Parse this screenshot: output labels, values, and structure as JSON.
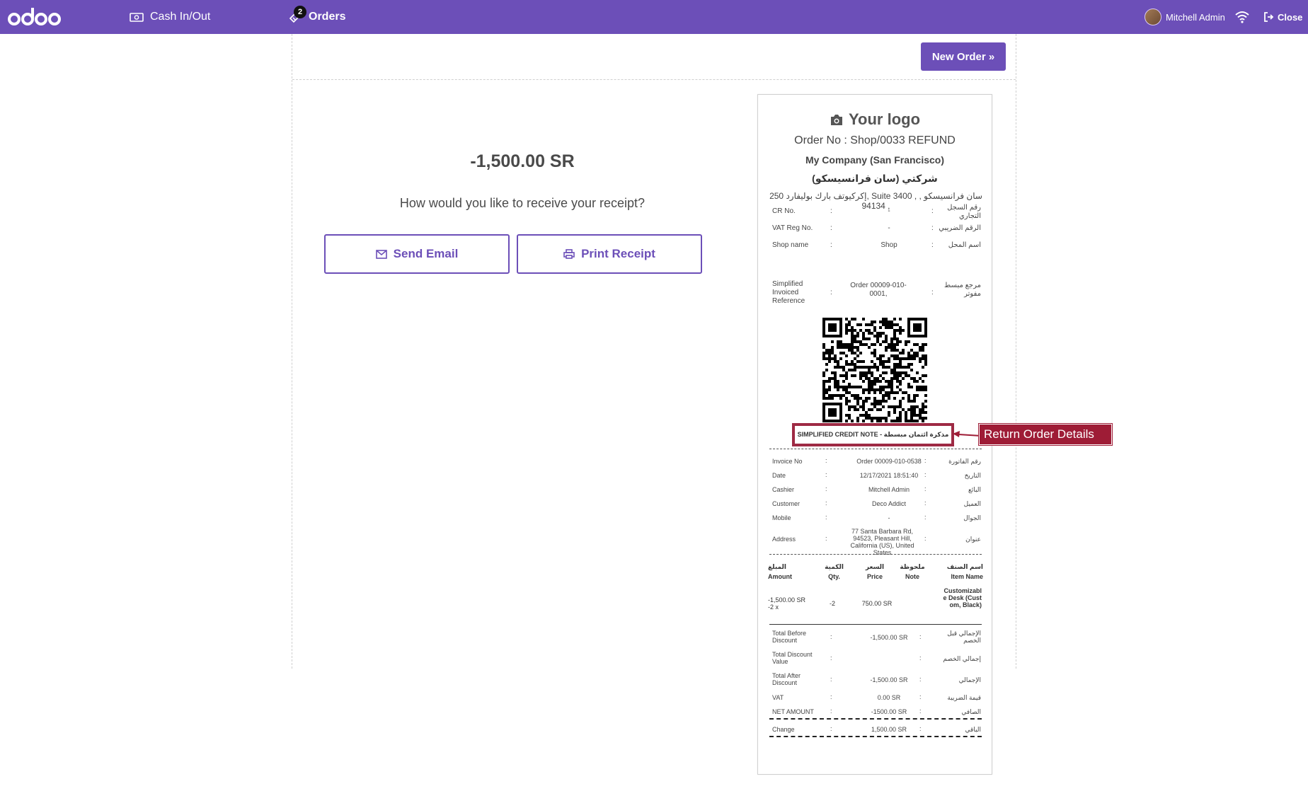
{
  "topbar": {
    "logo_text": "odoo",
    "cash_label": "Cash In/Out",
    "orders_label": "Orders",
    "orders_count": "2",
    "user_name": "Mitchell Admin",
    "close_label": "Close",
    "brand_color": "#6c4fb8"
  },
  "main": {
    "new_order_label": "New Order »",
    "amount": "-1,500.00 SR",
    "question": "How would you like to receive your receipt?",
    "send_email_label": "Send Email",
    "print_receipt_label": "Print Receipt"
  },
  "receipt": {
    "logo_text": "Your logo",
    "order_no": "Order No : Shop/0033 REFUND",
    "company": "My Company (San Francisco)",
    "company_ar": "شركتي (سان فرانسيسكو)",
    "address_line1": "سان فرانسيسكو , , Suite 3400 ,إكركيوتف بارك بوليفارد 250",
    "address_line2": "94134 ,",
    "header_rows": [
      {
        "key": "CR No.",
        "value": "-",
        "ar": "رقم السجل التجاري"
      },
      {
        "key": "VAT Reg No.",
        "value": "-",
        "ar": "الرقم الضريبي"
      },
      {
        "key": "Shop name",
        "value": "Shop",
        "ar": "اسم المحل"
      },
      {
        "key": "Simplified Invoiced Reference",
        "value": "Order 00009-010-0001,",
        "ar": "مرجع مبسط مفوتر"
      }
    ],
    "credit_note": "SIMPLIFIED CREDIT NOTE - مذكرة ائتمان مبسطة",
    "callout": "Return Order Details",
    "callout_color": "#9e1c36",
    "detail_rows": [
      {
        "key": "Invoice No",
        "value": "Order 00009-010-0538",
        "ar": "رقم الفاتورة"
      },
      {
        "key": "Date",
        "value": "12/17/2021 18:51:40",
        "ar": "التاريخ"
      },
      {
        "key": "Cashier",
        "value": "Mitchell Admin",
        "ar": "البائع"
      },
      {
        "key": "Customer",
        "value": "Deco Addict",
        "ar": "العميل"
      },
      {
        "key": "Mobile",
        "value": "-",
        "ar": "الجوال"
      },
      {
        "key": "Address",
        "value": "77 Santa Barbara Rd, 94523, Pleasant Hill, California (US), United States",
        "ar": "عنوان"
      }
    ],
    "table_headers": [
      {
        "ar": "المبلغ",
        "en": "Amount"
      },
      {
        "ar": "الكمية",
        "en": "Qty."
      },
      {
        "ar": "السعر",
        "en": "Price"
      },
      {
        "ar": "ملحوظة",
        "en": "Note"
      },
      {
        "ar": "اسم الصنف",
        "en": "Item Name"
      }
    ],
    "line": {
      "amount": "-1,500.00 SR",
      "amount_sub": "-2 x",
      "qty": "-2",
      "price": "750.00 SR",
      "note": "",
      "item": "Customizable Desk (Custom, Black)"
    },
    "totals": [
      {
        "key": "Total Before Discount",
        "value": "-1,500.00 SR",
        "ar": "الإجمالي قبل الخصم"
      },
      {
        "key": "Total Discount Value",
        "value": "",
        "ar": "إجمالي الخصم"
      },
      {
        "key": "Total After Discount",
        "value": "-1,500.00 SR",
        "ar": "الإجمالي"
      },
      {
        "key": "VAT",
        "value": "0.00 SR",
        "ar": "قيمة الضريبة"
      },
      {
        "key": "NET AMOUNT",
        "value": "-1500.00 SR",
        "ar": "الصافي"
      }
    ],
    "change": {
      "key": "Change",
      "value": "1,500.00 SR",
      "ar": "الباقي"
    }
  }
}
